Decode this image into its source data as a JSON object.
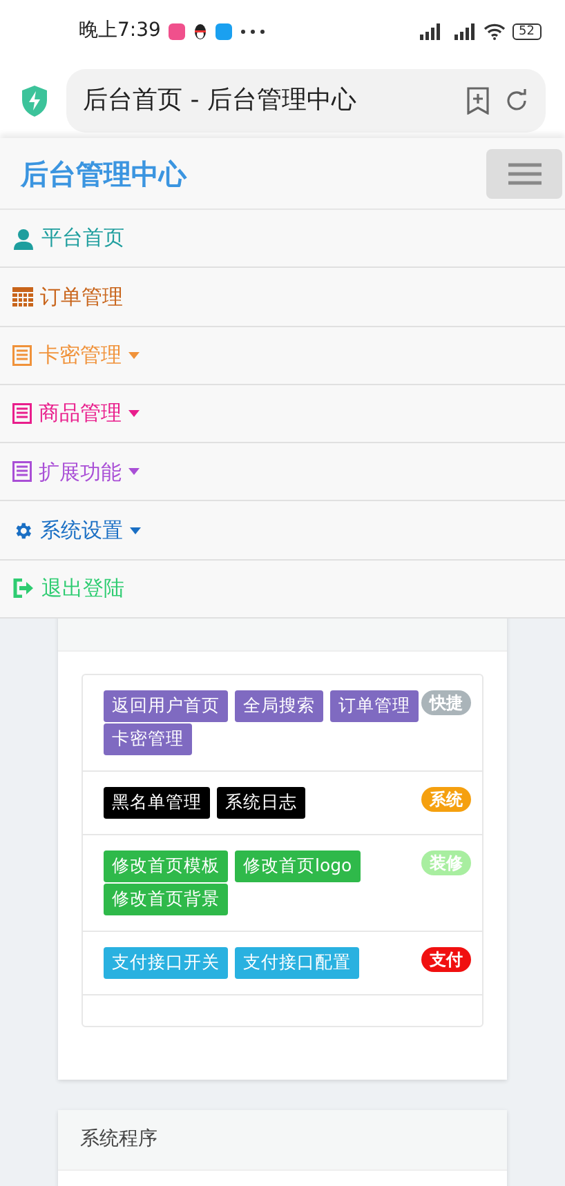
{
  "status_bar": {
    "time": "晚上7:39",
    "battery": "52"
  },
  "browser": {
    "title": "后台首页 - 后台管理中心"
  },
  "navbar": {
    "brand": "后台管理中心",
    "menu_expanded": true
  },
  "menu": [
    {
      "label": "平台首页",
      "kind": "user",
      "color": "#1e9e9e",
      "dropdown": false
    },
    {
      "label": "订单管理",
      "kind": "calendar",
      "color": "#c8641a",
      "dropdown": false
    },
    {
      "label": "卡密管理",
      "kind": "list",
      "color": "#f0923a",
      "dropdown": true
    },
    {
      "label": "商品管理",
      "kind": "list",
      "color": "#e91e8c",
      "dropdown": true
    },
    {
      "label": "扩展功能",
      "kind": "list",
      "color": "#a94fd6",
      "dropdown": true
    },
    {
      "label": "系统设置",
      "kind": "gear",
      "color": "#1a6fc4",
      "dropdown": true
    },
    {
      "label": "退出登陆",
      "kind": "logout",
      "color": "#2ecc71",
      "dropdown": false
    }
  ],
  "function_list": {
    "groups": [
      {
        "color": "#7f6ac1",
        "buttons": [
          "返回用户首页",
          "全局搜索",
          "订单管理",
          "卡密管理"
        ],
        "badge": {
          "label": "快捷",
          "color": "#aab4b9"
        }
      },
      {
        "color": "#000000",
        "buttons": [
          "黑名单管理",
          "系统日志"
        ],
        "badge": {
          "label": "系统",
          "color": "#f5a00f"
        }
      },
      {
        "color": "#2fb94a",
        "buttons": [
          "修改首页模板",
          "修改首页logo",
          "修改首页背景"
        ],
        "badge": {
          "label": "装修",
          "color": "#a8eea0"
        }
      },
      {
        "color": "#29b1e0",
        "buttons": [
          "支付接口开关",
          "支付接口配置"
        ],
        "badge": {
          "label": "支付",
          "color": "#f01010"
        }
      }
    ]
  },
  "system_program": {
    "title": "系统程序"
  }
}
